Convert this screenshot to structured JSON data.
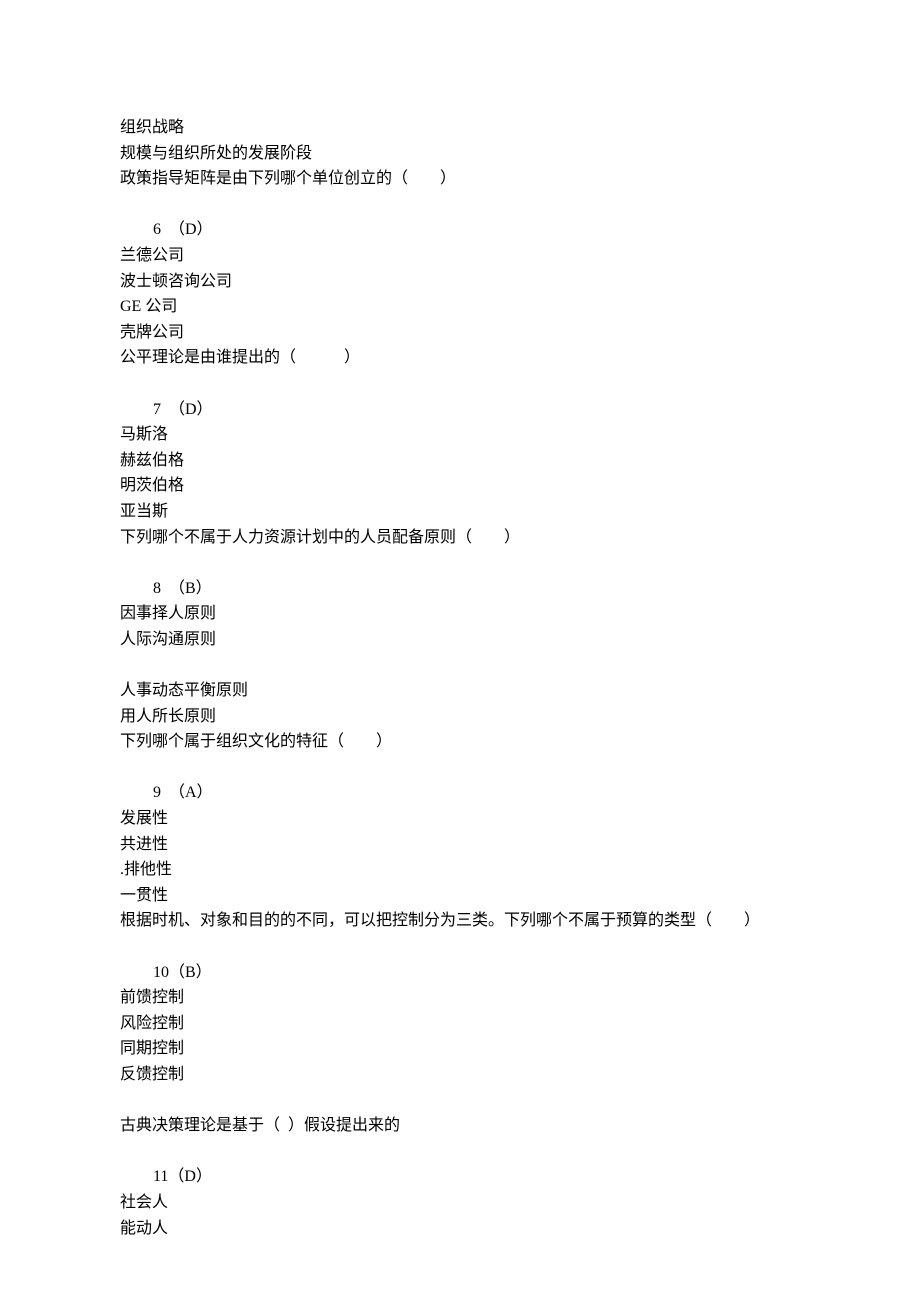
{
  "lines": {
    "l1": "组织战略",
    "l2": "规模与组织所处的发展阶段",
    "l3": "政策指导矩阵是由下列哪个单位创立的（　　）",
    "q6": "6  （D）",
    "l4": "兰德公司",
    "l5": "波士顿咨询公司",
    "l6": "GE 公司",
    "l7": "壳牌公司",
    "l8": "公平理论是由谁提出的（　　　）",
    "q7": "7  （D）",
    "l9": "马斯洛",
    "l10": "赫兹伯格",
    "l11": "明茨伯格",
    "l12": "亚当斯",
    "l13": "下列哪个不属于人力资源计划中的人员配备原则（　　）",
    "q8": "8  （B）",
    "l14": "因事择人原则",
    "l15": "人际沟通原则",
    "l16": "人事动态平衡原则",
    "l17": "用人所长原则",
    "l18": "下列哪个属于组织文化的特征（　　）",
    "q9": "9  （A）",
    "l19": "发展性",
    "l20": "共进性",
    "l21": ".排他性",
    "l22": "一贯性",
    "l23": "根据时机、对象和目的的不同，可以把控制分为三类。下列哪个不属于预算的类型（　　）",
    "q10": "10（B）",
    "l24": "前馈控制",
    "l25": "风险控制",
    "l26": "同期控制",
    "l27": "反馈控制",
    "l28": "古典决策理论是基于（  ）假设提出来的",
    "q11": "11（D）",
    "l29": "社会人",
    "l30": "能动人"
  }
}
